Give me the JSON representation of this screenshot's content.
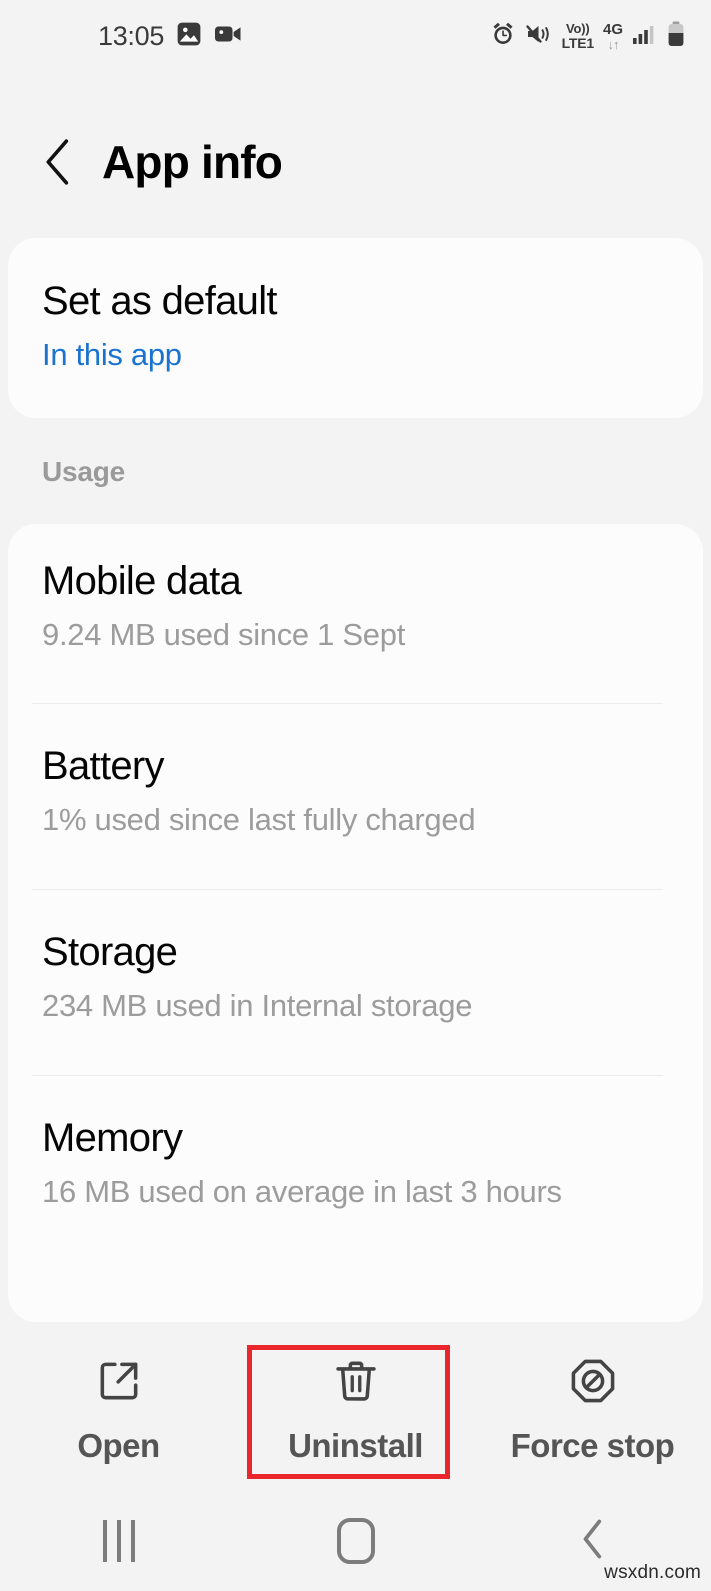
{
  "status_bar": {
    "time": "13:05",
    "left_icons": [
      "image-icon",
      "video-camera-icon"
    ],
    "right_icons": [
      "alarm-icon",
      "mute-vibrate-icon",
      "signal-bars-icon",
      "battery-icon"
    ],
    "volte_top": "Vo))",
    "volte_bottom": "LTE1",
    "network_type": "4G",
    "data_arrows": "↓↑"
  },
  "header": {
    "back_icon": "back-chevron-icon",
    "title": "App info"
  },
  "default_card": {
    "title": "Set as default",
    "subtitle": "In this app"
  },
  "usage_section": {
    "label": "Usage",
    "rows": [
      {
        "title": "Mobile data",
        "subtitle": "9.24 MB used since 1 Sept"
      },
      {
        "title": "Battery",
        "subtitle": "1% used since last fully charged"
      },
      {
        "title": "Storage",
        "subtitle": "234 MB used in Internal storage"
      },
      {
        "title": "Memory",
        "subtitle": "16 MB used on average in last 3 hours"
      }
    ]
  },
  "actions": [
    {
      "label": "Open",
      "icon": "open-in-new-icon"
    },
    {
      "label": "Uninstall",
      "icon": "trash-icon",
      "highlighted": true
    },
    {
      "label": "Force stop",
      "icon": "force-stop-icon"
    }
  ],
  "nav_bar": {
    "recents": "recents-icon",
    "home": "home-icon",
    "back": "back-icon"
  },
  "watermark": "wsxdn.com",
  "colors": {
    "background": "#f3f3f3",
    "card": "#fcfcfc",
    "accent_blue": "#1a73cf",
    "highlight_red": "#e8262b",
    "primary_text": "#050505",
    "secondary_text": "#9c9c9c"
  }
}
